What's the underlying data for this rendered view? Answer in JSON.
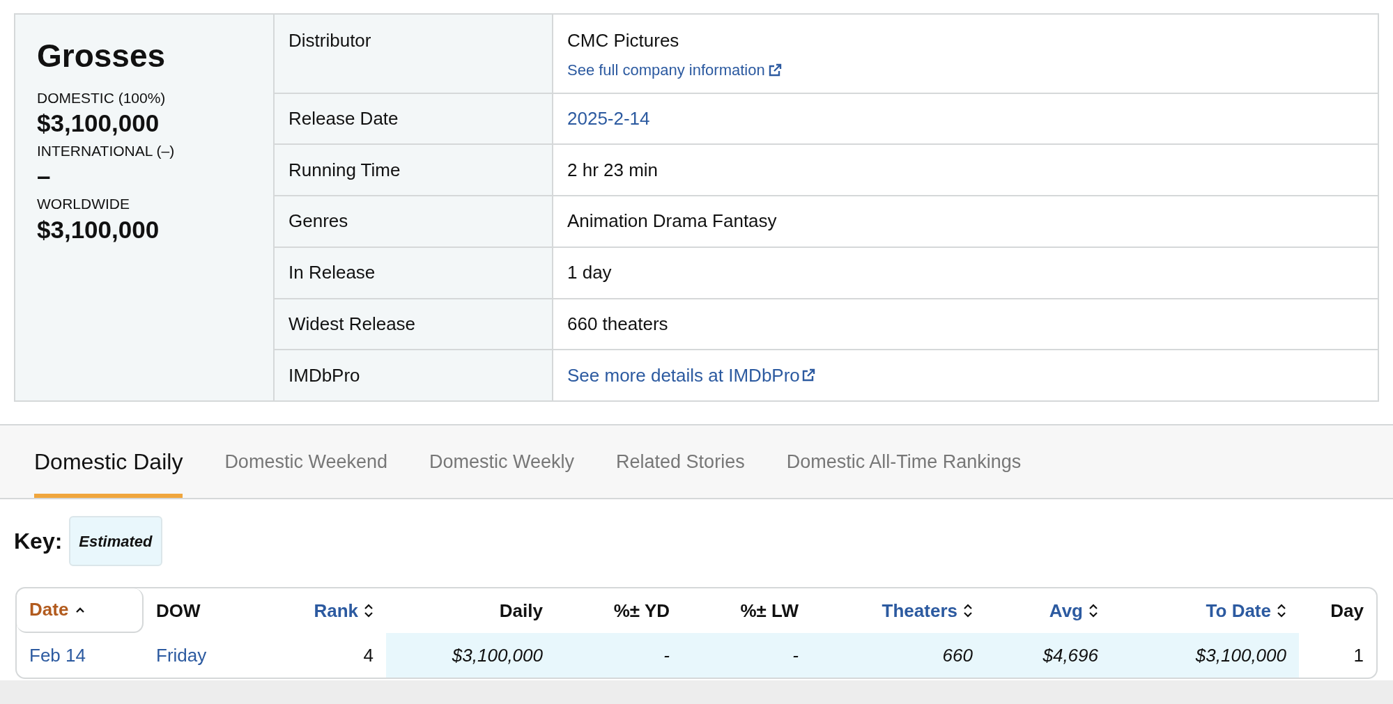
{
  "grosses": {
    "title": "Grosses",
    "items": [
      {
        "label": "DOMESTIC (100%)",
        "amount": "$3,100,000"
      },
      {
        "label": "INTERNATIONAL (–)",
        "amount": "–"
      },
      {
        "label": "WORLDWIDE",
        "amount": "$3,100,000"
      }
    ]
  },
  "summary": [
    {
      "label": "Distributor",
      "value": "CMC Pictures",
      "link": false,
      "sublink": "See full company information"
    },
    {
      "label": "Release Date",
      "value": "2025-2-14",
      "link": true
    },
    {
      "label": "Running Time",
      "value": "2 hr 23 min",
      "link": false
    },
    {
      "label": "Genres",
      "value": "Animation Drama Fantasy",
      "link": false
    },
    {
      "label": "In Release",
      "value": "1 day",
      "link": false
    },
    {
      "label": "Widest Release",
      "value": "660 theaters",
      "link": false
    },
    {
      "label": "IMDbPro",
      "value": "See more details at IMDbPro",
      "link": true,
      "external": true
    }
  ],
  "tabs": [
    {
      "label": "Domestic Daily",
      "selected": true
    },
    {
      "label": "Domestic Weekend",
      "selected": false
    },
    {
      "label": "Domestic Weekly",
      "selected": false
    },
    {
      "label": "Related Stories",
      "selected": false
    },
    {
      "label": "Domestic All-Time Rankings",
      "selected": false
    }
  ],
  "key": {
    "label": "Key:",
    "badge": "Estimated"
  },
  "table": {
    "columns": [
      {
        "label": "Date",
        "sortable": true,
        "sorted": true
      },
      {
        "label": "DOW",
        "sortable": false
      },
      {
        "label": "Rank",
        "sortable": true,
        "sorted": false
      },
      {
        "label": "Daily",
        "sortable": false
      },
      {
        "label": "%± YD",
        "sortable": false
      },
      {
        "label": "%± LW",
        "sortable": false
      },
      {
        "label": "Theaters",
        "sortable": true,
        "sorted": false
      },
      {
        "label": "Avg",
        "sortable": true,
        "sorted": false
      },
      {
        "label": "To Date",
        "sortable": true,
        "sorted": false
      },
      {
        "label": "Day",
        "sortable": false
      }
    ],
    "rows": [
      {
        "cells": [
          {
            "text": "Feb 14",
            "link": true,
            "estimated": false
          },
          {
            "text": "Friday",
            "link": true,
            "estimated": false
          },
          {
            "text": "4",
            "link": false,
            "estimated": false
          },
          {
            "text": "$3,100,000",
            "link": false,
            "estimated": true
          },
          {
            "text": "-",
            "link": false,
            "estimated": true
          },
          {
            "text": "-",
            "link": false,
            "estimated": true
          },
          {
            "text": "660",
            "link": false,
            "estimated": true
          },
          {
            "text": "$4,696",
            "link": false,
            "estimated": true
          },
          {
            "text": "$3,100,000",
            "link": false,
            "estimated": true
          },
          {
            "text": "1",
            "link": false,
            "estimated": false
          }
        ]
      }
    ]
  }
}
